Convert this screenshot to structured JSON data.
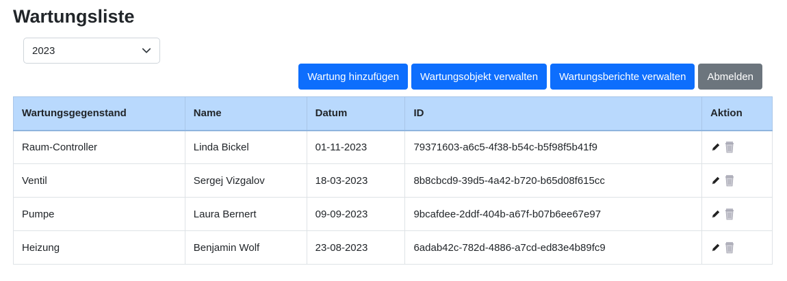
{
  "page": {
    "title": "Wartungsliste"
  },
  "filter": {
    "year_selected": "2023"
  },
  "toolbar": {
    "buttons": [
      {
        "label": "Wartung hinzufügen",
        "style": "primary"
      },
      {
        "label": "Wartungsobjekt verwalten",
        "style": "primary"
      },
      {
        "label": "Wartungsberichte verwalten",
        "style": "primary"
      },
      {
        "label": "Abmelden",
        "style": "secondary"
      }
    ]
  },
  "table": {
    "columns": [
      "Wartungsgegenstand",
      "Name",
      "Datum",
      "ID",
      "Aktion"
    ],
    "rows": [
      {
        "item": "Raum-Controller",
        "name": "Linda Bickel",
        "date": "01-11-2023",
        "id": "79371603-a6c5-4f38-b54c-b5f98f5b41f9",
        "edit_icon": "pencil-icon",
        "delete_icon": "trash-icon"
      },
      {
        "item": "Ventil",
        "name": "Sergej Vizgalov",
        "date": "18-03-2023",
        "id": "8b8cbcd9-39d5-4a42-b720-b65d08f615cc",
        "edit_icon": "pencil-icon",
        "delete_icon": "trash-icon"
      },
      {
        "item": "Pumpe",
        "name": "Laura Bernert",
        "date": "09-09-2023",
        "id": "9bcafdee-2ddf-404b-a67f-b07b6ee67e97",
        "edit_icon": "pencil-icon",
        "delete_icon": "trash-icon"
      },
      {
        "item": "Heizung",
        "name": "Benjamin Wolf",
        "date": "23-08-2023",
        "id": "6adab42c-782d-4886-a7cd-ed83e4b89fc9",
        "edit_icon": "pencil-icon",
        "delete_icon": "trash-icon"
      }
    ]
  },
  "colors": {
    "primary": "#0d6efd",
    "secondary": "#6c757d",
    "table_header": "#b9d9fd"
  }
}
